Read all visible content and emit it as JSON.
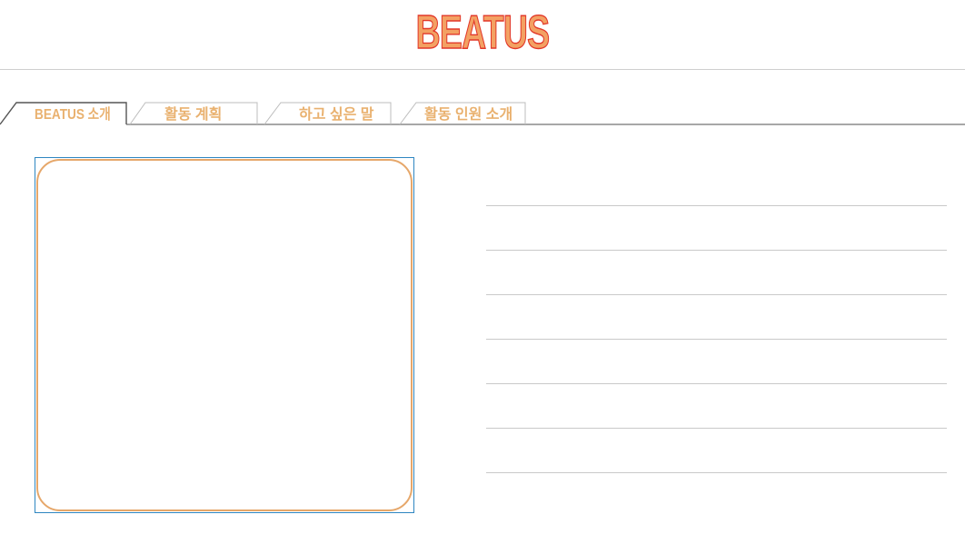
{
  "header": {
    "logo_text": "BEATUS"
  },
  "tabs": [
    {
      "label": "BEATUS 소개",
      "active": true
    },
    {
      "label": "활동 계획",
      "active": false
    },
    {
      "label": "하고 싶은 말",
      "active": false
    },
    {
      "label": "활동 인원 소개",
      "active": false
    }
  ],
  "colors": {
    "logo_fill": "#f3a163",
    "logo_stroke": "#e2382a",
    "tab_text": "#e9b16f",
    "card_border": "#e6a76a",
    "frame_border": "#2e86c1",
    "line": "#c9c9c9"
  },
  "content": {
    "lines": [
      "",
      "",
      "",
      "",
      "",
      "",
      ""
    ]
  }
}
